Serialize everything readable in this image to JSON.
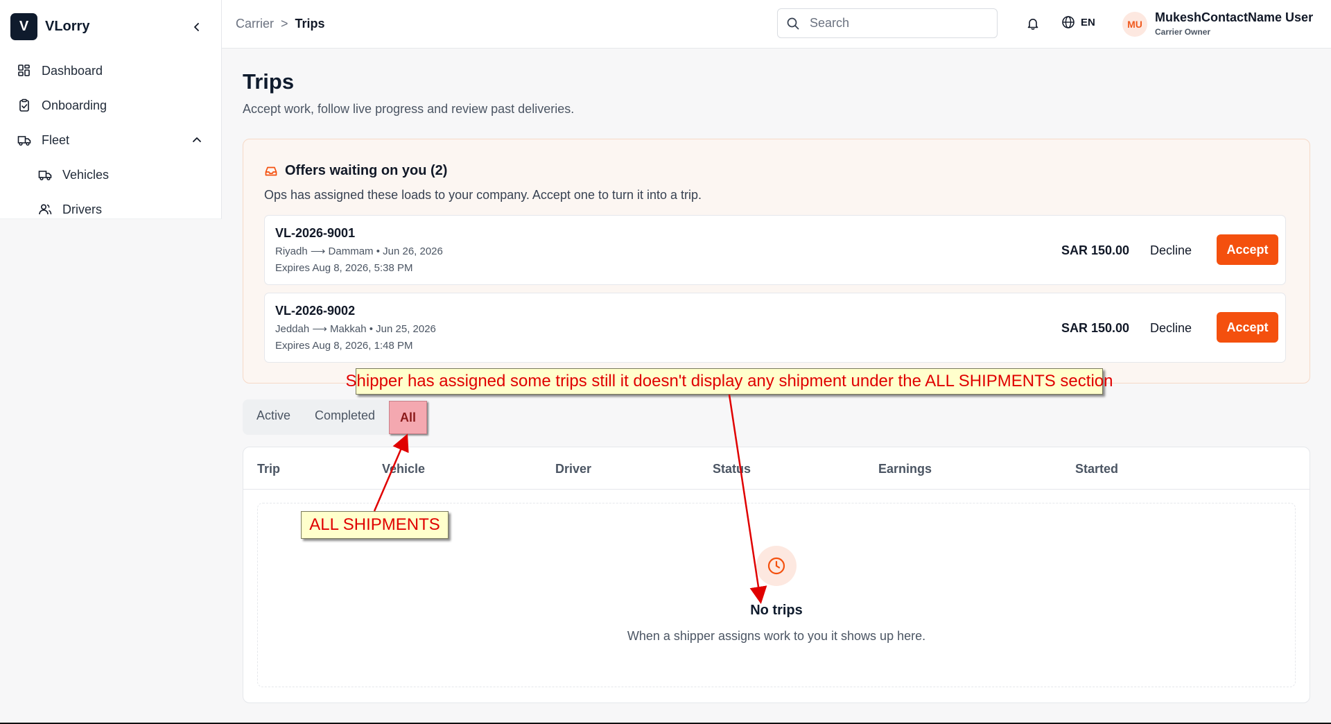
{
  "brand": {
    "logo_letter": "V",
    "name": "VLorry"
  },
  "sidebar": {
    "items": [
      {
        "label": "Dashboard",
        "icon": "dashboard-icon"
      },
      {
        "label": "Onboarding",
        "icon": "clipboard-icon"
      },
      {
        "label": "Fleet",
        "icon": "truck-icon",
        "expanded": true
      },
      {
        "label": "Vehicles",
        "icon": "truck-icon"
      },
      {
        "label": "Drivers",
        "icon": "users-icon"
      }
    ]
  },
  "header": {
    "breadcrumb": {
      "parent": "Carrier",
      "separator": ">",
      "current": "Trips"
    },
    "search": {
      "placeholder": "Search"
    },
    "language": "EN",
    "user": {
      "initials": "MU",
      "name": "MukeshContactName User",
      "role": "Carrier Owner"
    }
  },
  "page": {
    "title": "Trips",
    "subtitle": "Accept work, follow live progress and review past deliveries."
  },
  "offers": {
    "title": "Offers waiting on you (2)",
    "subtitle": "Ops has assigned these loads to your company. Accept one to turn it into a trip.",
    "items": [
      {
        "id": "VL-2026-9001",
        "route": "Riyadh ⟶ Dammam • Jun 26, 2026",
        "expires": "Expires Aug 8, 2026, 5:38 PM",
        "price": "SAR 150.00",
        "decline_label": "Decline",
        "accept_label": "Accept"
      },
      {
        "id": "VL-2026-9002",
        "route": "Jeddah ⟶ Makkah • Jun 25, 2026",
        "expires": "Expires Aug 8, 2026, 1:48 PM",
        "price": "SAR 150.00",
        "decline_label": "Decline",
        "accept_label": "Accept"
      }
    ]
  },
  "tabs": [
    {
      "label": "Active"
    },
    {
      "label": "Completed"
    },
    {
      "label": "All",
      "selected": true
    }
  ],
  "table": {
    "columns": [
      "Trip",
      "Vehicle",
      "Driver",
      "Status",
      "Earnings",
      "Started"
    ],
    "empty": {
      "title": "No trips",
      "subtitle": "When a shipper assigns work to you it shows up here."
    }
  },
  "annotations": {
    "callout_main": "Shipper has assigned some trips still it doesn't display any shipment under the ALL SHIPMENTS  section",
    "callout_tab": "ALL SHIPMENTS"
  },
  "colors": {
    "accent": "#f4500e",
    "brand_dark": "#0f1b2d",
    "annotation_red": "#e00000",
    "callout_bg": "#ffffcc"
  }
}
